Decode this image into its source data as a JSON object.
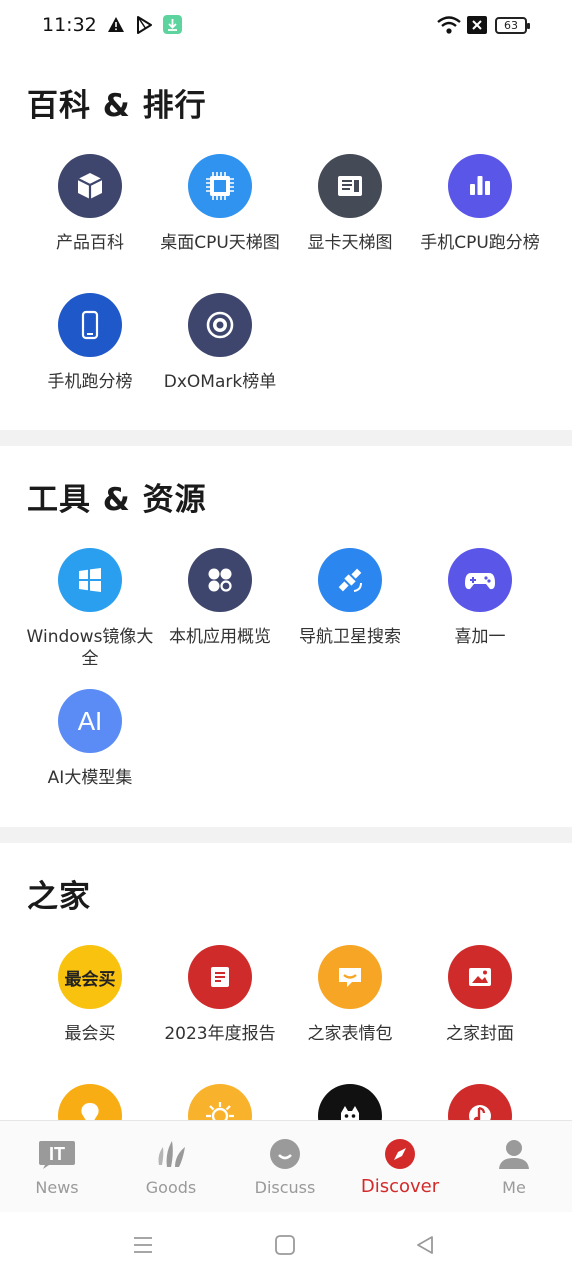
{
  "status_bar": {
    "time": "11:32",
    "battery": "63"
  },
  "sections": [
    {
      "title": "百科 & 排行",
      "items": [
        {
          "label": "产品百科",
          "icon": "cube-icon",
          "color": "#3e466d"
        },
        {
          "label": "桌面CPU天梯图",
          "icon": "cpu-chip-icon",
          "color": "#2f93ef"
        },
        {
          "label": "显卡天梯图",
          "icon": "graphics-card-icon",
          "color": "#454a57"
        },
        {
          "label": "手机CPU跑分榜",
          "icon": "bar-chart-icon",
          "color": "#5a56e8"
        },
        {
          "label": "手机跑分榜",
          "icon": "smartphone-icon",
          "color": "#1f58c9"
        },
        {
          "label": "DxOMark榜单",
          "icon": "camera-lens-icon",
          "color": "#3e466d"
        }
      ]
    },
    {
      "title": "工具 & 资源",
      "items": [
        {
          "label": "Windows镜像大全",
          "icon": "windows-logo-icon",
          "color": "#2a9ff0"
        },
        {
          "label": "本机应用概览",
          "icon": "apps-grid-icon",
          "color": "#3e466d"
        },
        {
          "label": "导航卫星搜索",
          "icon": "satellite-icon",
          "color": "#2b86f0"
        },
        {
          "label": "喜加一",
          "icon": "gamepad-icon",
          "color": "#5a56e8"
        },
        {
          "label": "AI大模型集",
          "icon": "ai-icon",
          "color": "#5b8cf5"
        }
      ]
    },
    {
      "title": "之家",
      "items": [
        {
          "label": "最会买",
          "icon": "zuihuimai-logo-icon",
          "color": "#f8c20e",
          "glyph": "最会买"
        },
        {
          "label": "2023年度报告",
          "icon": "report-icon",
          "color": "#cf2b2b"
        },
        {
          "label": "之家表情包",
          "icon": "sticker-icon",
          "color": "#f7a524"
        },
        {
          "label": "之家封面",
          "icon": "picture-icon",
          "color": "#cf2b2b"
        },
        {
          "label": "",
          "icon": "location-pin-icon",
          "color": "#f9ad14"
        },
        {
          "label": "",
          "icon": "sun-icon",
          "color": "#f9b22c"
        },
        {
          "label": "",
          "icon": "mascot-icon",
          "color": "#111111"
        },
        {
          "label": "",
          "icon": "music-icon",
          "color": "#cf2b2b"
        }
      ]
    }
  ],
  "bottom_nav": [
    {
      "label": "News",
      "icon": "it-logo-icon"
    },
    {
      "label": "Goods",
      "icon": "goods-icon"
    },
    {
      "label": "Discuss",
      "icon": "discuss-icon"
    },
    {
      "label": "Discover",
      "icon": "compass-icon",
      "active": true
    },
    {
      "label": "Me",
      "icon": "person-icon"
    }
  ],
  "colors": {
    "accent": "#d32a2a",
    "inactive": "#9a9a9a",
    "divider": "#f2f2f2"
  }
}
